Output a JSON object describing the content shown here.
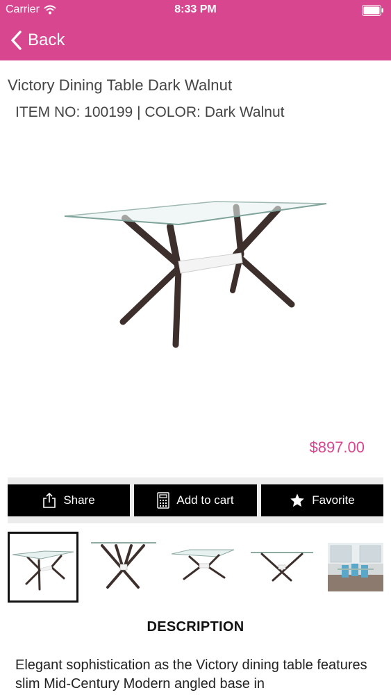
{
  "status_bar": {
    "carrier": "Carrier",
    "time": "8:33 PM"
  },
  "nav": {
    "back_label": "Back",
    "background_color": "#d8468f"
  },
  "product": {
    "title": "Victory Dining Table Dark Walnut",
    "meta": "ITEM NO: 100199 | COLOR: Dark Walnut",
    "price": "$897.00",
    "price_color": "#d8468f"
  },
  "actions": {
    "share_label": "Share",
    "cart_label": "Add to cart",
    "favorite_label": "Favorite"
  },
  "thumbnails": [
    {
      "name": "thumb-table-angle",
      "selected": true
    },
    {
      "name": "thumb-table-front",
      "selected": false
    },
    {
      "name": "thumb-table-side",
      "selected": false
    },
    {
      "name": "thumb-table-end",
      "selected": false
    },
    {
      "name": "thumb-dining-room",
      "selected": false
    }
  ],
  "description": {
    "heading": "DESCRIPTION",
    "text": "Elegant sophistication as the Victory dining table features slim Mid-Century Modern angled base in"
  }
}
